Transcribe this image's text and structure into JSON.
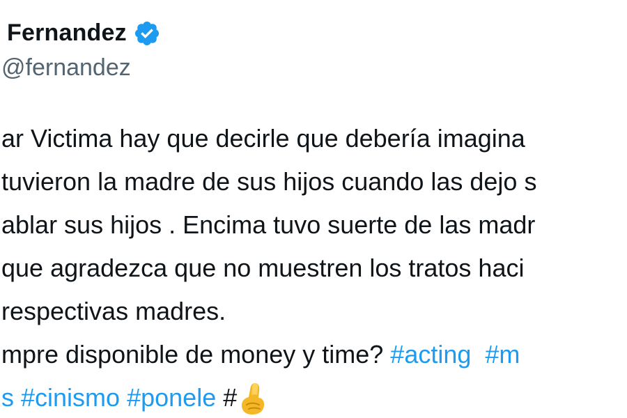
{
  "author": {
    "name": "Fernandez",
    "handle": "fernandez",
    "verified_color": "#1d9bf0"
  },
  "tweet": {
    "lines": [
      "ar Victima hay que decirle que debería imagina",
      "tuvieron la madre de sus hijos cuando las dejo s",
      "ablar sus hijos . Encima tuvo suerte de las madr",
      "que agradezca que no muestren los tratos haci",
      "respectivas madres.",
      "mpre disponible de money y time?",
      ""
    ],
    "line6_hashtags": [
      "#acting",
      "#m"
    ],
    "line7_hashtags": [
      "s",
      "#cinismo",
      "#ponele"
    ],
    "line7_trailing": "#",
    "emoji": "pinched-fingers-emoji"
  },
  "colors": {
    "text": "#0f1419",
    "secondary": "#536471",
    "link": "#1d9bf0"
  }
}
